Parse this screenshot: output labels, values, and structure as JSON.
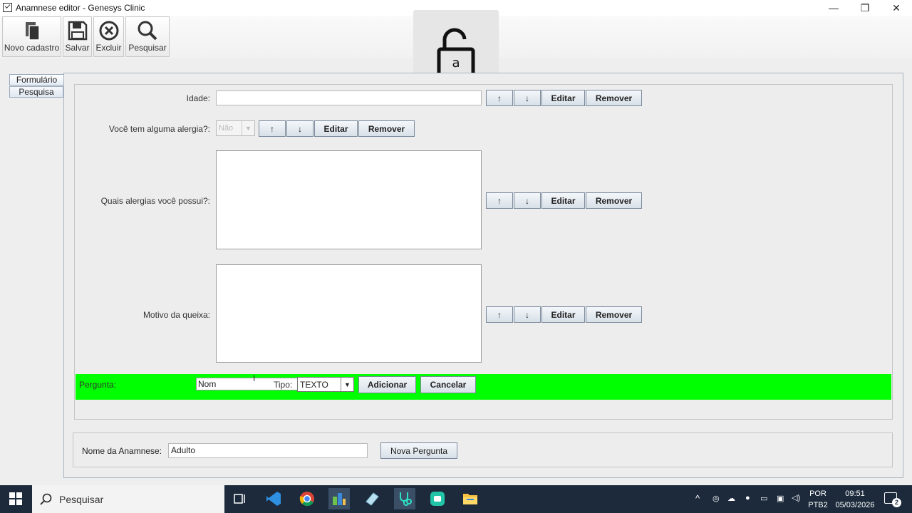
{
  "window": {
    "title": "Anamnese editor - Genesys Clinic",
    "minimize": "—",
    "restore": "❐",
    "close": "✕"
  },
  "toolbar": {
    "new_label": "Novo cadastro",
    "save_label": "Salvar",
    "delete_label": "Excluir",
    "search_label": "Pesquisar"
  },
  "tabs": {
    "form": "Formulário",
    "search": "Pesquisa"
  },
  "questions": [
    {
      "label": "Idade:",
      "type": "text",
      "value": ""
    },
    {
      "label": "Você tem alguma alergia?:",
      "type": "combo",
      "value": "Não"
    },
    {
      "label": "Quais alergias você possui?:",
      "type": "textarea",
      "value": ""
    },
    {
      "label": "Motivo da queixa:",
      "type": "textarea",
      "value": ""
    }
  ],
  "row_buttons": {
    "up": "↑",
    "down": "↓",
    "edit": "Editar",
    "remove": "Remover"
  },
  "new_question": {
    "question_label": "Pergunta:",
    "question_value": "Nom",
    "type_label": "Tipo:",
    "type_value": "TEXTO",
    "add_label": "Adicionar",
    "cancel_label": "Cancelar",
    "bar_color": "#00ff00"
  },
  "anamnese": {
    "name_label": "Nome da Anamnese:",
    "name_value": "Adulto",
    "new_question_label": "Nova Pergunta"
  },
  "taskbar": {
    "search_placeholder": "Pesquisar",
    "lang_top": "POR",
    "lang_bottom": "PTB2",
    "time": "09:51",
    "date": "05/03/2026",
    "notifications": "2"
  }
}
